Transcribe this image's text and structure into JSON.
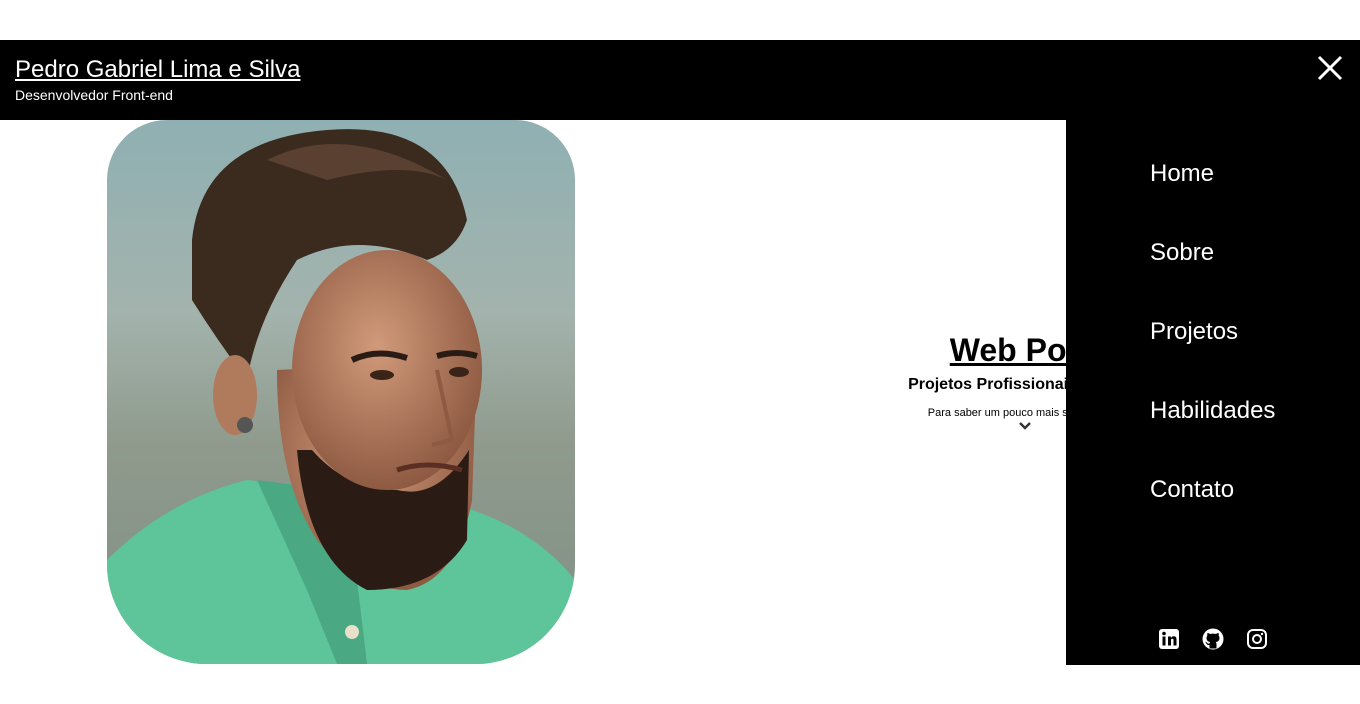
{
  "header": {
    "name": "Pedro Gabriel Lima e Silva",
    "role": "Desenvolvedor Front-end"
  },
  "hero": {
    "title": "Web Portf",
    "subtitle": "Projetos Profissionais, Pessoa",
    "intro": "Para saber um pouco mais sobre Pedro"
  },
  "menu": {
    "items": [
      {
        "label": "Home"
      },
      {
        "label": "Sobre"
      },
      {
        "label": "Projetos"
      },
      {
        "label": "Habilidades"
      },
      {
        "label": "Contato"
      }
    ]
  },
  "socials": [
    "linkedin-icon",
    "github-icon",
    "instagram-icon"
  ],
  "colors": {
    "header_bg": "#000000",
    "menu_bg": "#000000",
    "text_light": "#ffffff",
    "shirt": "#5ec49a"
  }
}
